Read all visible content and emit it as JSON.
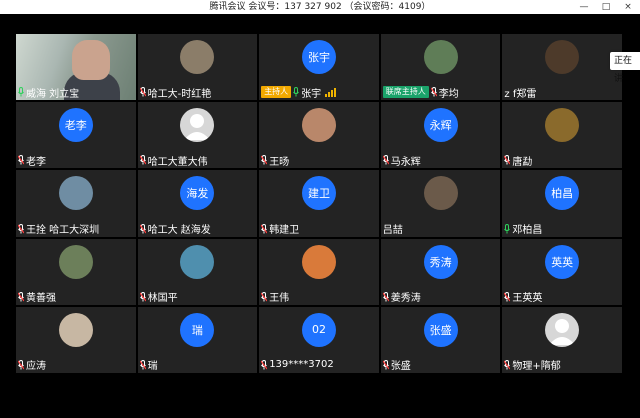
{
  "window": {
    "title": "腾讯会议 会议号：137 327 902 （会议密码：4109）",
    "controls": [
      "—",
      "□",
      "×"
    ]
  },
  "speaking_indicator": "正在讲",
  "participants": [
    {
      "name": "威海 刘立宝",
      "avatar_type": "video",
      "mic": "on"
    },
    {
      "name": "哈工大-时红艳",
      "avatar_type": "photo",
      "photo_color": "#8b7d69",
      "mic": "off"
    },
    {
      "name": "张宇",
      "avatar_type": "text",
      "avatar_text": "张宇",
      "role": "主持人",
      "role_type": "host",
      "mic": "on",
      "signal": true
    },
    {
      "name": "李均",
      "avatar_type": "photo",
      "photo_color": "#5f7d57",
      "role": "联席主持人",
      "role_type": "cohost",
      "mic": "off"
    },
    {
      "name": "z f郑雷",
      "avatar_type": "photo",
      "photo_color": "#4d3a2a",
      "mic": "none"
    },
    {
      "name": "老李",
      "avatar_type": "text",
      "avatar_text": "老李",
      "mic": "off"
    },
    {
      "name": "哈工大董大伟",
      "avatar_type": "photo",
      "photo_color": "#d6d6d6",
      "default": true,
      "mic": "off"
    },
    {
      "name": "王旸",
      "avatar_type": "photo",
      "photo_color": "#b9876a",
      "mic": "off"
    },
    {
      "name": "马永辉",
      "avatar_type": "text",
      "avatar_text": "永辉",
      "mic": "off"
    },
    {
      "name": "唐勐",
      "avatar_type": "photo",
      "photo_color": "#8a6a2c",
      "mic": "off"
    },
    {
      "name": "王拴 哈工大深圳",
      "avatar_type": "photo",
      "photo_color": "#6f8da3",
      "mic": "off"
    },
    {
      "name": "哈工大 赵海发",
      "avatar_type": "text",
      "avatar_text": "海发",
      "mic": "off"
    },
    {
      "name": "韩建卫",
      "avatar_type": "text",
      "avatar_text": "建卫",
      "mic": "off"
    },
    {
      "name": "吕喆",
      "avatar_type": "photo",
      "photo_color": "#6b5a4a",
      "mic": "none"
    },
    {
      "name": "邓柏昌",
      "avatar_type": "text",
      "avatar_text": "柏昌",
      "mic": "on"
    },
    {
      "name": "黄善强",
      "avatar_type": "photo",
      "photo_color": "#6c7f5a",
      "mic": "off"
    },
    {
      "name": "林国平",
      "avatar_type": "photo",
      "photo_color": "#4f8fae",
      "mic": "off"
    },
    {
      "name": "王伟",
      "avatar_type": "photo",
      "photo_color": "#d97a3a",
      "mic": "off"
    },
    {
      "name": "姜秀涛",
      "avatar_type": "text",
      "avatar_text": "秀涛",
      "mic": "off"
    },
    {
      "name": "王英英",
      "avatar_type": "text",
      "avatar_text": "英英",
      "mic": "off"
    },
    {
      "name": "应涛",
      "avatar_type": "photo",
      "photo_color": "#c7b7a3",
      "mic": "off"
    },
    {
      "name": "瑞",
      "avatar_type": "text",
      "avatar_text": "瑞",
      "mic": "off"
    },
    {
      "name": "139****3702",
      "avatar_type": "text",
      "avatar_text": "02",
      "mic": "off"
    },
    {
      "name": "张盛",
      "avatar_type": "text",
      "avatar_text": "张盛",
      "mic": "off"
    },
    {
      "name": "物理+隋郁",
      "avatar_type": "photo",
      "photo_color": "#d6d6d6",
      "default": true,
      "mic": "off"
    }
  ]
}
